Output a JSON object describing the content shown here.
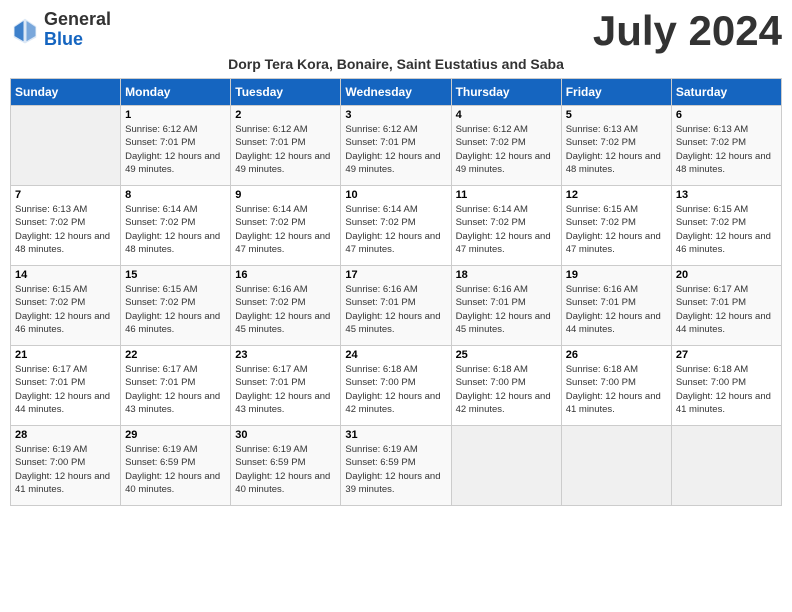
{
  "header": {
    "logo_general": "General",
    "logo_blue": "Blue",
    "month_title": "July 2024",
    "subtitle": "Dorp Tera Kora, Bonaire, Saint Eustatius and Saba"
  },
  "days_of_week": [
    "Sunday",
    "Monday",
    "Tuesday",
    "Wednesday",
    "Thursday",
    "Friday",
    "Saturday"
  ],
  "weeks": [
    [
      {
        "day": "",
        "sunrise": "",
        "sunset": "",
        "daylight": ""
      },
      {
        "day": "1",
        "sunrise": "6:12 AM",
        "sunset": "7:01 PM",
        "daylight": "12 hours and 49 minutes."
      },
      {
        "day": "2",
        "sunrise": "6:12 AM",
        "sunset": "7:01 PM",
        "daylight": "12 hours and 49 minutes."
      },
      {
        "day": "3",
        "sunrise": "6:12 AM",
        "sunset": "7:01 PM",
        "daylight": "12 hours and 49 minutes."
      },
      {
        "day": "4",
        "sunrise": "6:12 AM",
        "sunset": "7:02 PM",
        "daylight": "12 hours and 49 minutes."
      },
      {
        "day": "5",
        "sunrise": "6:13 AM",
        "sunset": "7:02 PM",
        "daylight": "12 hours and 48 minutes."
      },
      {
        "day": "6",
        "sunrise": "6:13 AM",
        "sunset": "7:02 PM",
        "daylight": "12 hours and 48 minutes."
      }
    ],
    [
      {
        "day": "7",
        "sunrise": "6:13 AM",
        "sunset": "7:02 PM",
        "daylight": "12 hours and 48 minutes."
      },
      {
        "day": "8",
        "sunrise": "6:14 AM",
        "sunset": "7:02 PM",
        "daylight": "12 hours and 48 minutes."
      },
      {
        "day": "9",
        "sunrise": "6:14 AM",
        "sunset": "7:02 PM",
        "daylight": "12 hours and 47 minutes."
      },
      {
        "day": "10",
        "sunrise": "6:14 AM",
        "sunset": "7:02 PM",
        "daylight": "12 hours and 47 minutes."
      },
      {
        "day": "11",
        "sunrise": "6:14 AM",
        "sunset": "7:02 PM",
        "daylight": "12 hours and 47 minutes."
      },
      {
        "day": "12",
        "sunrise": "6:15 AM",
        "sunset": "7:02 PM",
        "daylight": "12 hours and 47 minutes."
      },
      {
        "day": "13",
        "sunrise": "6:15 AM",
        "sunset": "7:02 PM",
        "daylight": "12 hours and 46 minutes."
      }
    ],
    [
      {
        "day": "14",
        "sunrise": "6:15 AM",
        "sunset": "7:02 PM",
        "daylight": "12 hours and 46 minutes."
      },
      {
        "day": "15",
        "sunrise": "6:15 AM",
        "sunset": "7:02 PM",
        "daylight": "12 hours and 46 minutes."
      },
      {
        "day": "16",
        "sunrise": "6:16 AM",
        "sunset": "7:02 PM",
        "daylight": "12 hours and 45 minutes."
      },
      {
        "day": "17",
        "sunrise": "6:16 AM",
        "sunset": "7:01 PM",
        "daylight": "12 hours and 45 minutes."
      },
      {
        "day": "18",
        "sunrise": "6:16 AM",
        "sunset": "7:01 PM",
        "daylight": "12 hours and 45 minutes."
      },
      {
        "day": "19",
        "sunrise": "6:16 AM",
        "sunset": "7:01 PM",
        "daylight": "12 hours and 44 minutes."
      },
      {
        "day": "20",
        "sunrise": "6:17 AM",
        "sunset": "7:01 PM",
        "daylight": "12 hours and 44 minutes."
      }
    ],
    [
      {
        "day": "21",
        "sunrise": "6:17 AM",
        "sunset": "7:01 PM",
        "daylight": "12 hours and 44 minutes."
      },
      {
        "day": "22",
        "sunrise": "6:17 AM",
        "sunset": "7:01 PM",
        "daylight": "12 hours and 43 minutes."
      },
      {
        "day": "23",
        "sunrise": "6:17 AM",
        "sunset": "7:01 PM",
        "daylight": "12 hours and 43 minutes."
      },
      {
        "day": "24",
        "sunrise": "6:18 AM",
        "sunset": "7:00 PM",
        "daylight": "12 hours and 42 minutes."
      },
      {
        "day": "25",
        "sunrise": "6:18 AM",
        "sunset": "7:00 PM",
        "daylight": "12 hours and 42 minutes."
      },
      {
        "day": "26",
        "sunrise": "6:18 AM",
        "sunset": "7:00 PM",
        "daylight": "12 hours and 41 minutes."
      },
      {
        "day": "27",
        "sunrise": "6:18 AM",
        "sunset": "7:00 PM",
        "daylight": "12 hours and 41 minutes."
      }
    ],
    [
      {
        "day": "28",
        "sunrise": "6:19 AM",
        "sunset": "7:00 PM",
        "daylight": "12 hours and 41 minutes."
      },
      {
        "day": "29",
        "sunrise": "6:19 AM",
        "sunset": "6:59 PM",
        "daylight": "12 hours and 40 minutes."
      },
      {
        "day": "30",
        "sunrise": "6:19 AM",
        "sunset": "6:59 PM",
        "daylight": "12 hours and 40 minutes."
      },
      {
        "day": "31",
        "sunrise": "6:19 AM",
        "sunset": "6:59 PM",
        "daylight": "12 hours and 39 minutes."
      },
      {
        "day": "",
        "sunrise": "",
        "sunset": "",
        "daylight": ""
      },
      {
        "day": "",
        "sunrise": "",
        "sunset": "",
        "daylight": ""
      },
      {
        "day": "",
        "sunrise": "",
        "sunset": "",
        "daylight": ""
      }
    ]
  ]
}
